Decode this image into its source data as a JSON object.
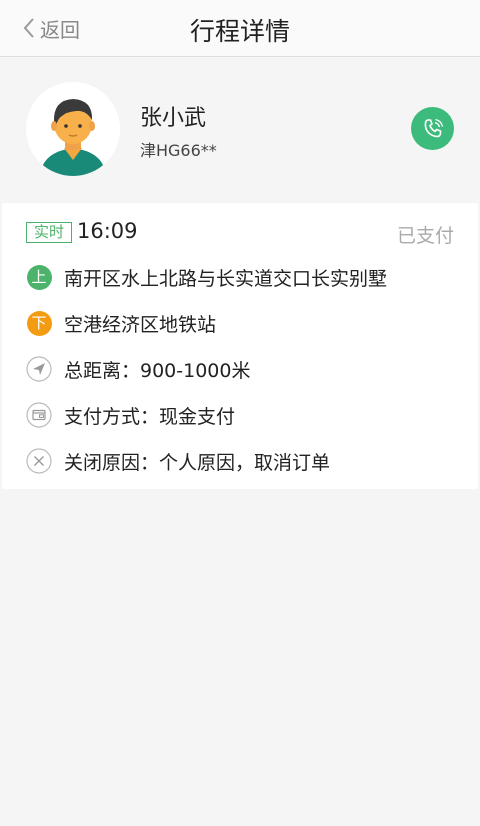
{
  "nav": {
    "back_label": "返回",
    "title": "行程详情"
  },
  "driver": {
    "name": "张小武",
    "plate": "津HG66**",
    "call_icon": "phone-icon",
    "call_button_color": "#3dbb7d"
  },
  "trip": {
    "badge": "实时",
    "time": "16:09",
    "status": "已支付",
    "pickup_badge": "上",
    "pickup": "南开区水上北路与长实道交口长实别墅",
    "dropoff_badge": "下",
    "dropoff": "空港经济区地铁站",
    "distance": "总距离：900-1000米",
    "payment": "支付方式：现金支付",
    "close_reason": "关闭原因：个人原因，取消订单"
  },
  "colors": {
    "accent_green": "#4cb36a",
    "pickup_green": "#4cb36a",
    "dropoff_orange": "#f39c12"
  }
}
